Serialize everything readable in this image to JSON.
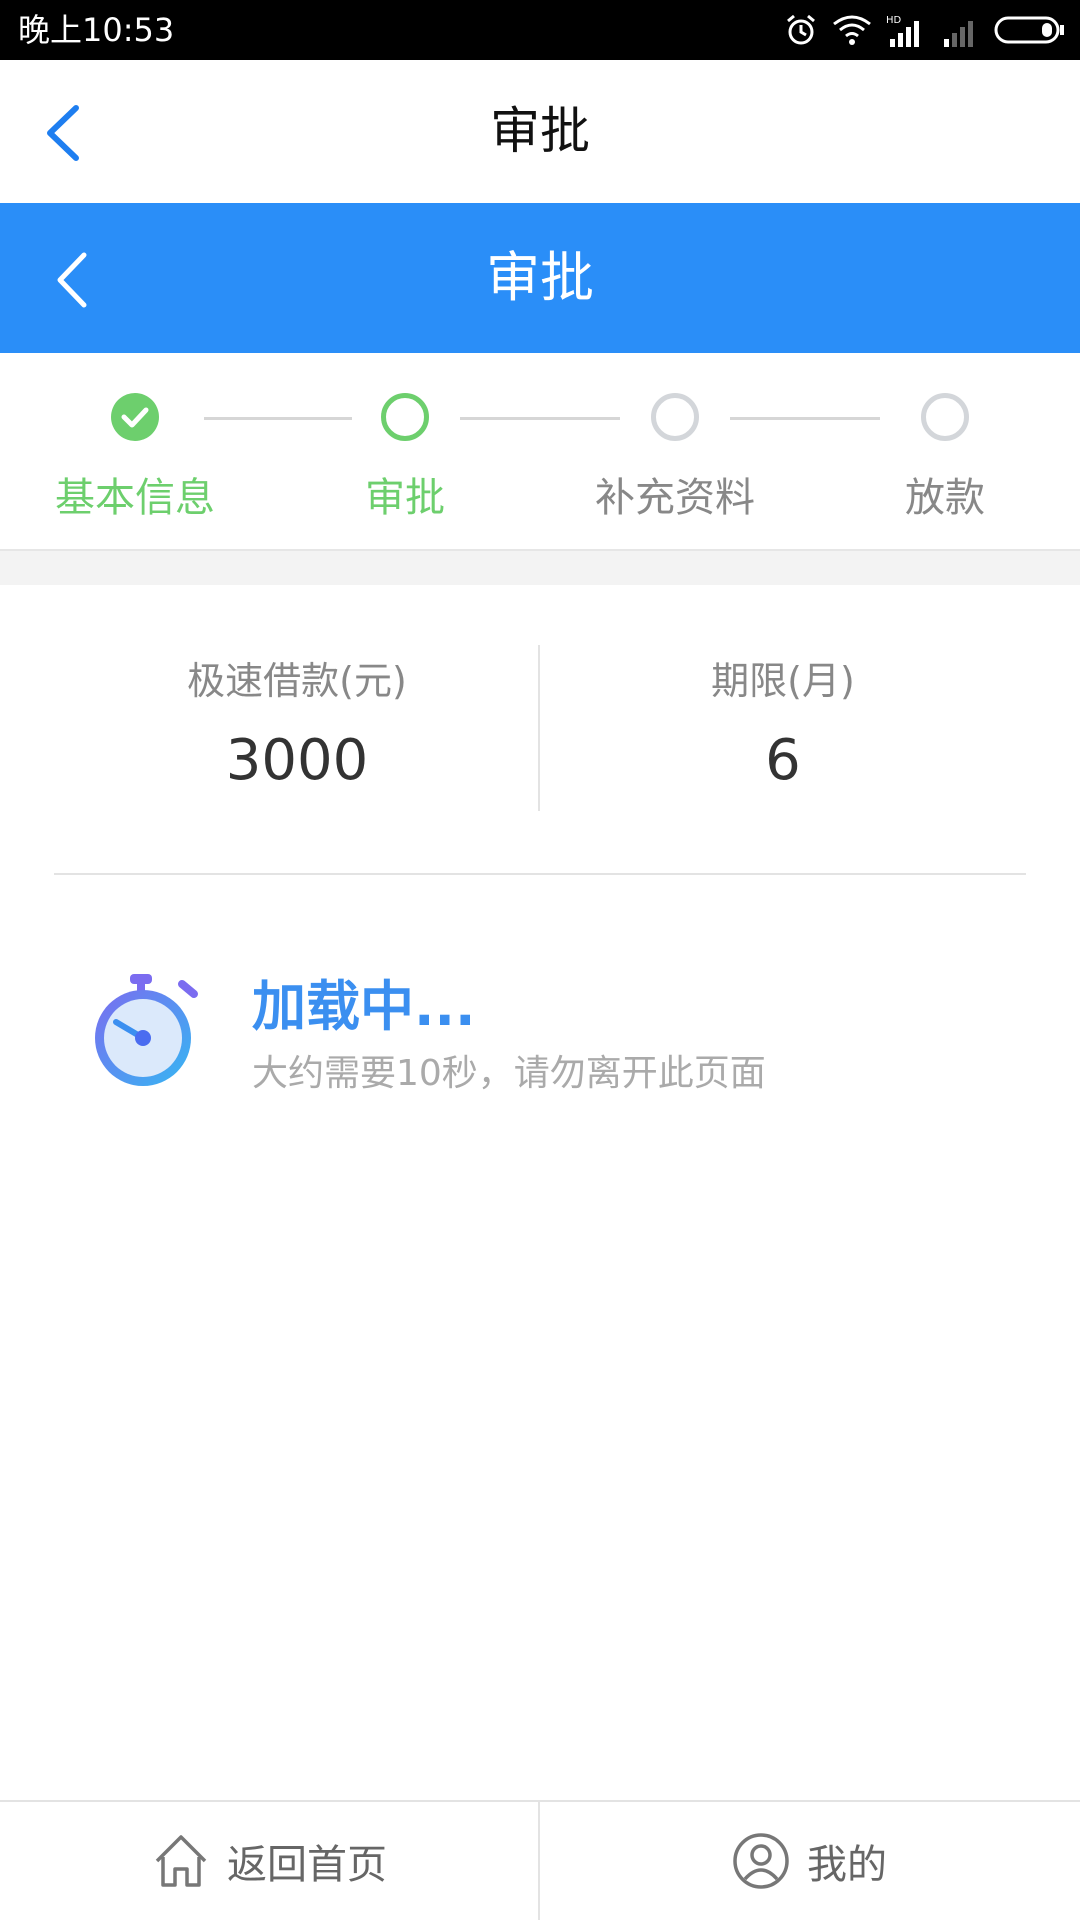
{
  "status_bar": {
    "time": "晚上10:53"
  },
  "top_nav": {
    "title": "审批"
  },
  "blue_header": {
    "title": "审批"
  },
  "stepper": {
    "steps": [
      {
        "label": "基本信息",
        "state": "done"
      },
      {
        "label": "审批",
        "state": "current"
      },
      {
        "label": "补充资料",
        "state": "todo"
      },
      {
        "label": "放款",
        "state": "todo"
      }
    ]
  },
  "loan_info": {
    "amount_label": "极速借款(元)",
    "amount_value": "3000",
    "term_label": "期限(月)",
    "term_value": "6"
  },
  "loading": {
    "title": "加载中...",
    "subtitle": "大约需要10秒，请勿离开此页面"
  },
  "bottom_nav": {
    "home_label": "返回首页",
    "mine_label": "我的"
  },
  "colors": {
    "header_blue": "#2a8ef8",
    "step_green": "#6dcf6d",
    "loading_blue": "#3b8ff0"
  }
}
